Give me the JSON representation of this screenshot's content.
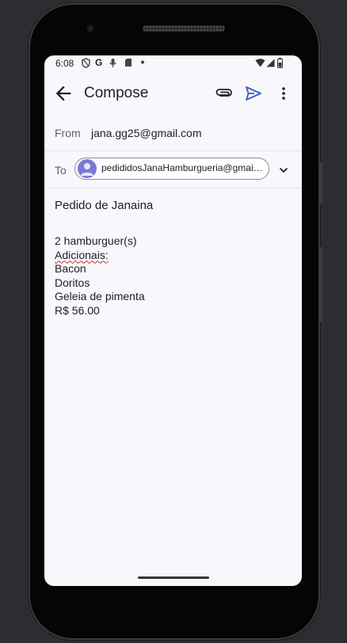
{
  "status_bar": {
    "time": "6:08",
    "left_icons": [
      "shield-icon",
      "google-g-icon",
      "mic-icon",
      "sd-card-icon",
      "dot-icon"
    ],
    "right_icons": [
      "wifi-icon",
      "signal-icon",
      "battery-icon"
    ]
  },
  "app_bar": {
    "title": "Compose",
    "icons": [
      "back-arrow-icon",
      "attachment-icon",
      "send-icon",
      "more-vert-icon"
    ]
  },
  "from": {
    "label": "From",
    "value": "jana.gg25@gmail.com"
  },
  "to": {
    "label": "To",
    "recipient": "pedididosJanaHamburgueria@gmail.com"
  },
  "subject": "Pedido de Janaina",
  "body": {
    "line1": "2 hamburguer(s)",
    "line2": "Adicionais:",
    "line3": "Bacon",
    "line4": "Doritos",
    "line5": "Geleia de pimenta",
    "line6": "R$ 56.00"
  },
  "colors": {
    "accent": "#3c5bbd",
    "avatar": "#7a79d6",
    "background": "#f7f7fc"
  }
}
